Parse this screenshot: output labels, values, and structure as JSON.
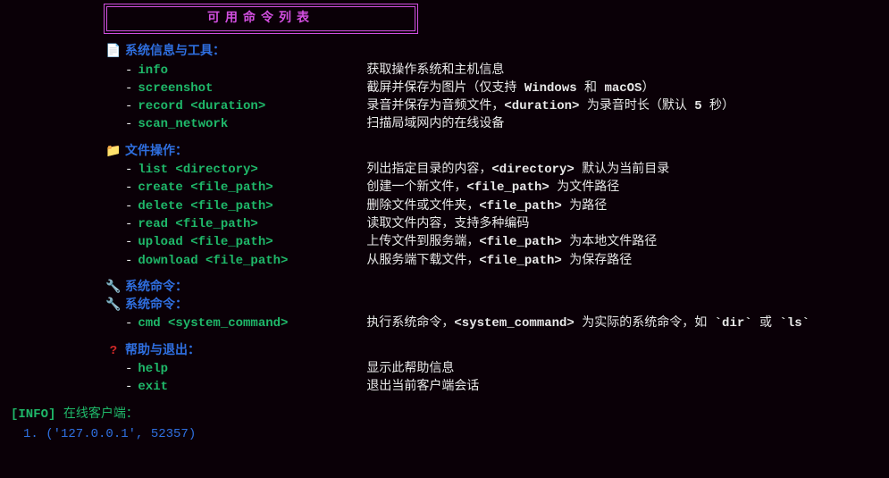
{
  "title": "可用命令列表",
  "sections": [
    {
      "icon": "doc-icon",
      "iconName": "document-icon",
      "heading": "系统信息与工具：",
      "commands": [
        {
          "cmd": "info",
          "args": "",
          "desc": "获取操作系统和主机信息"
        },
        {
          "cmd": "screenshot",
          "args": "",
          "desc": "截屏并保存为图片（仅支持 <b>Windows</b> 和 <b>macOS</b>）"
        },
        {
          "cmd": "record",
          "args": " <duration>",
          "desc": "录音并保存为音频文件，<b>&lt;duration&gt;</b> 为录音时长（默认 <b>5</b> 秒）"
        },
        {
          "cmd": "scan_network",
          "args": "",
          "desc": "扫描局域网内的在线设备"
        }
      ]
    },
    {
      "icon": "folder-icon",
      "iconName": "folder-icon",
      "heading": "文件操作：",
      "commands": [
        {
          "cmd": "list",
          "args": " <directory>",
          "desc": "列出指定目录的内容，<b>&lt;directory&gt;</b> 默认为当前目录"
        },
        {
          "cmd": "create",
          "args": " <file_path>",
          "desc": "创建一个新文件，<b>&lt;file_path&gt;</b> 为文件路径"
        },
        {
          "cmd": "delete",
          "args": " <file_path>",
          "desc": "删除文件或文件夹，<b>&lt;file_path&gt;</b> 为路径"
        },
        {
          "cmd": "read",
          "args": " <file_path>",
          "desc": "读取文件内容，支持多种编码"
        },
        {
          "cmd": "upload",
          "args": " <file_path>",
          "desc": "上传文件到服务端，<b>&lt;file_path&gt;</b> 为本地文件路径"
        },
        {
          "cmd": "download",
          "args": " <file_path>",
          "desc": "从服务端下载文件，<b>&lt;file_path&gt;</b> 为保存路径"
        }
      ]
    },
    {
      "icon": "wrench-icon",
      "iconName": "wrench-icon",
      "heading": "系统命令：",
      "duplicate": true,
      "commands": [
        {
          "cmd": "cmd",
          "args": " <system_command>",
          "desc": "执行系统命令，<b>&lt;system_command&gt;</b> 为实际的系统命令，如 <b>`dir`</b> 或 <b>`ls`</b>"
        }
      ]
    },
    {
      "icon": "question-icon",
      "iconName": "help-icon",
      "heading": "帮助与退出：",
      "commands": [
        {
          "cmd": "help",
          "args": "",
          "desc": "显示此帮助信息"
        },
        {
          "cmd": "exit",
          "args": "",
          "desc": "退出当前客户端会话"
        }
      ]
    }
  ],
  "status": {
    "tag": "[INFO]",
    "label": "在线客户端：",
    "clients": [
      {
        "index": "1.",
        "addr": "('127.0.0.1', 52357)"
      }
    ]
  }
}
